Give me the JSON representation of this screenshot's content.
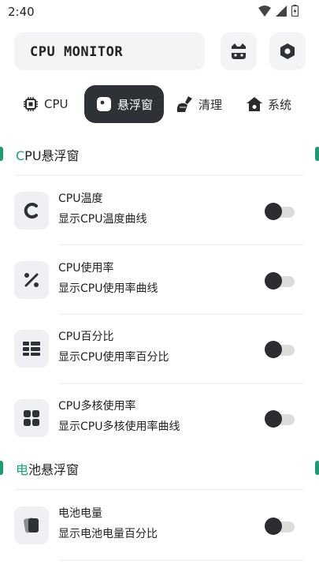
{
  "status": {
    "time": "2:40"
  },
  "header": {
    "title": "CPU MONITOR",
    "left_icon": "cat-face-icon",
    "right_icon": "hex-nut-icon"
  },
  "tabs": [
    {
      "label": "CPU",
      "icon": "chip-icon",
      "active": false
    },
    {
      "label": "悬浮窗",
      "icon": "float-window-icon",
      "active": true
    },
    {
      "label": "清理",
      "icon": "broom-icon",
      "active": false
    },
    {
      "label": "系统",
      "icon": "home-icon",
      "active": false
    }
  ],
  "sections": [
    {
      "title_accent": "C",
      "title_rest": "PU悬浮窗",
      "items": [
        {
          "title": "CPU温度",
          "subtitle": "显示CPU温度曲线",
          "icon": "temperature-c-icon",
          "enabled": false
        },
        {
          "title": "CPU使用率",
          "subtitle": "显示CPU使用率曲线",
          "icon": "percent-icon",
          "enabled": false
        },
        {
          "title": "CPU百分比",
          "subtitle": "显示CPU使用率百分比",
          "icon": "list-grid-icon",
          "enabled": false
        },
        {
          "title": "CPU多核使用率",
          "subtitle": "显示CPU多核使用率曲线",
          "icon": "four-squares-icon",
          "enabled": false
        }
      ]
    },
    {
      "title_accent": "电",
      "title_rest": "池悬浮窗",
      "items": [
        {
          "title": "电池电量",
          "subtitle": "显示电池电量百分比",
          "icon": "battery-cards-icon",
          "enabled": false
        }
      ]
    }
  ],
  "colors": {
    "accent": "#1aa37a",
    "dark": "#2e3136",
    "surface": "#f3f4f6"
  }
}
